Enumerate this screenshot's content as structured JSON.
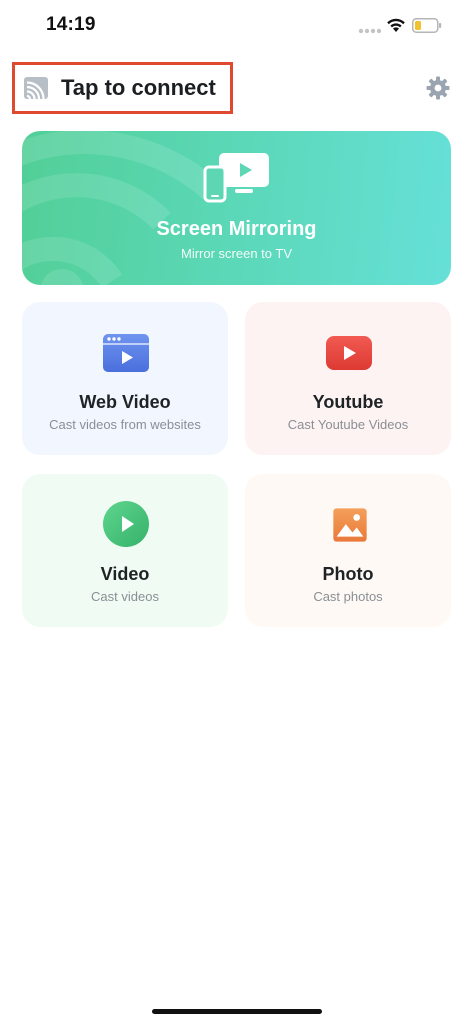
{
  "status_bar": {
    "time": "14:19"
  },
  "header": {
    "connect_label": "Tap to connect",
    "icons": {
      "cast": "cast-icon",
      "settings": "gear-icon"
    }
  },
  "mirroring": {
    "title": "Screen Mirroring",
    "subtitle": "Mirror screen to TV",
    "icon": "phone-tv-icon"
  },
  "features": [
    {
      "title": "Web Video",
      "subtitle": "Cast videos from websites",
      "icon": "browser-play-icon",
      "color": "#5a7fe3"
    },
    {
      "title": "Youtube",
      "subtitle": "Cast Youtube Videos",
      "icon": "youtube-icon",
      "color": "#e8473f"
    },
    {
      "title": "Video",
      "subtitle": "Cast videos",
      "icon": "play-circle-icon",
      "color": "#46c47a"
    },
    {
      "title": "Photo",
      "subtitle": "Cast photos",
      "icon": "image-icon",
      "color": "#ef8f4a"
    }
  ],
  "colors": {
    "accent_green": "#52cf97",
    "accent_teal": "#66e0d8",
    "highlight_box": "#e0482f"
  }
}
